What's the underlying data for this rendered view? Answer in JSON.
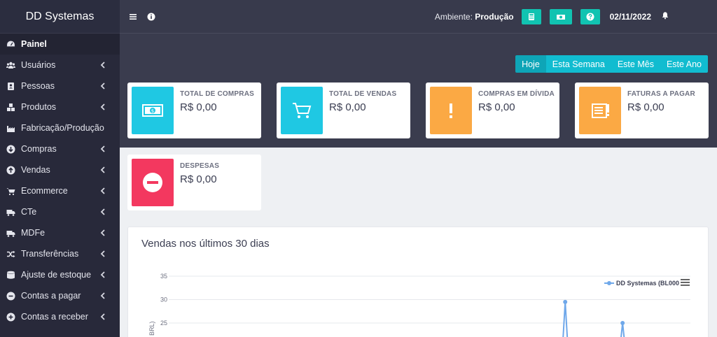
{
  "sidebar": {
    "brand": "DD Systemas",
    "items": [
      {
        "label": "Painel",
        "icon": "dashboard-icon",
        "active": true,
        "expandable": false
      },
      {
        "label": "Usuários",
        "icon": "users-icon",
        "expandable": true
      },
      {
        "label": "Pessoas",
        "icon": "address-book-icon",
        "expandable": true
      },
      {
        "label": "Produtos",
        "icon": "cubes-icon",
        "expandable": true
      },
      {
        "label": "Fabricação/Produção",
        "icon": "industry-icon",
        "expandable": false
      },
      {
        "label": "Compras",
        "icon": "arrow-circle-down-icon",
        "expandable": true
      },
      {
        "label": "Vendas",
        "icon": "arrow-circle-up-icon",
        "expandable": true
      },
      {
        "label": "Ecommerce",
        "icon": "cart-icon",
        "expandable": true
      },
      {
        "label": "CTe",
        "icon": "truck-icon",
        "expandable": true
      },
      {
        "label": "MDFe",
        "icon": "truck-icon",
        "expandable": true
      },
      {
        "label": "Transferências",
        "icon": "shuffle-icon",
        "expandable": true
      },
      {
        "label": "Ajuste de estoque",
        "icon": "database-icon",
        "expandable": true
      },
      {
        "label": "Contas a pagar",
        "icon": "minus-circle-icon",
        "expandable": true
      },
      {
        "label": "Contas a receber",
        "icon": "plus-circle-icon",
        "expandable": true
      }
    ]
  },
  "topbar": {
    "env_label": "Ambiente:",
    "env_value": "Produção",
    "date": "02/11/2022",
    "accent": "#11c3b1"
  },
  "periods": [
    "Hoje",
    "Esta Semana",
    "Este Mês",
    "Este Ano"
  ],
  "selected_period": "Hoje",
  "cards": [
    {
      "label": "TOTAL DE COMPRAS",
      "value": "R$ 0,00",
      "color": "#1fc8e3",
      "icon": "money-icon"
    },
    {
      "label": "TOTAL DE VENDAS",
      "value": "R$ 0,00",
      "color": "#1fc8e3",
      "icon": "cart-icon"
    },
    {
      "label": "COMPRAS EM DÍVIDA",
      "value": "R$ 0,00",
      "color": "#fba944",
      "icon": "exclamation-icon"
    },
    {
      "label": "FATURAS A PAGAR",
      "value": "R$ 0,00",
      "color": "#fba944",
      "icon": "invoice-icon"
    },
    {
      "label": "DESPESAS",
      "value": "R$ 0,00",
      "color": "#f3385f",
      "icon": "minus-circle-icon"
    }
  ],
  "chart": {
    "title": "Vendas nos últimos 30 dias",
    "legend": "DD Systemas (BL000",
    "ylabel_partial": "BRL)"
  },
  "chart_data": {
    "type": "line",
    "title": "Vendas nos últimos 30 dias",
    "ylabel": "BRL",
    "yticks": [
      35,
      30,
      25
    ],
    "series": [
      {
        "name": "DD Systemas (BL000",
        "color": "#6fa8ea",
        "points": [
          {
            "x": 0.76,
            "y": 29.5
          },
          {
            "x": 0.87,
            "y": 25
          }
        ]
      }
    ],
    "legend_position": "top-right",
    "grid": true
  }
}
